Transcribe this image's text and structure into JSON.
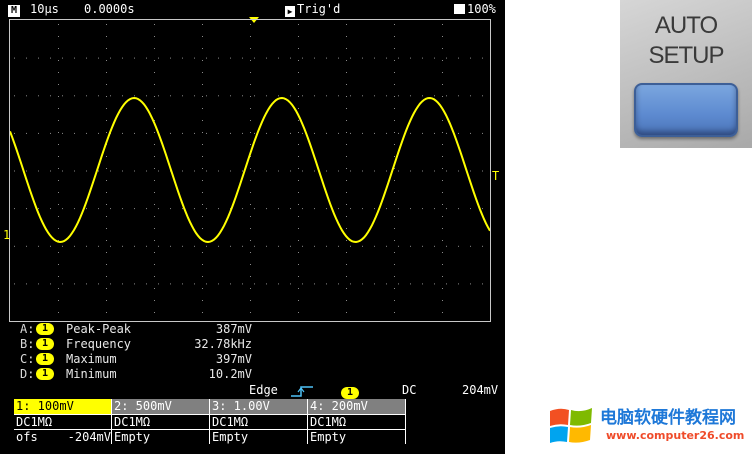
{
  "status_bar": {
    "mode_badge": "M",
    "timebase": "10µs",
    "time_offset": "0.0000s",
    "run_icon": "play-icon",
    "trigger_status": "Trig'd",
    "battery_icon": "battery-icon",
    "battery_level": "100%"
  },
  "waveform": {
    "channel_marker": "1",
    "trigger_level_marker": "T",
    "color": "#ffff00",
    "cycles_visible": 3.25
  },
  "measurements": [
    {
      "slot": "A:",
      "channel": "1",
      "label": "Peak-Peak",
      "value": "387mV"
    },
    {
      "slot": "B:",
      "channel": "1",
      "label": "Frequency",
      "value": "32.78kHz"
    },
    {
      "slot": "C:",
      "channel": "1",
      "label": "Maximum",
      "value": "397mV"
    },
    {
      "slot": "D:",
      "channel": "1",
      "label": "Minimum",
      "value": "10.2mV"
    }
  ],
  "trigger": {
    "type": "Edge",
    "slope_icon": "rising-edge-icon",
    "source": "1",
    "coupling": "DC",
    "level": "204mV"
  },
  "channels": [
    {
      "header": "1: 100mV",
      "coupling": "DC1MΩ",
      "extra_label": "ofs",
      "extra_value": "-204mV",
      "active": true
    },
    {
      "header": "2: 500mV",
      "coupling": "DC1MΩ",
      "extra_label": "Empty",
      "extra_value": "",
      "active": false
    },
    {
      "header": "3: 1.00V",
      "coupling": "DC1MΩ",
      "extra_label": "Empty",
      "extra_value": "",
      "active": false
    },
    {
      "header": "4: 200mV",
      "coupling": "DC1MΩ",
      "extra_label": "Empty",
      "extra_value": "",
      "active": false
    }
  ],
  "auto_setup_photo": {
    "line1": "AUTO",
    "line2": "SETUP",
    "button_color": "#5d8ad0"
  },
  "watermark": {
    "title": "电脑软硬件教程网",
    "url": "www.computer26.com",
    "logo_icon": "windows-logo-icon"
  }
}
